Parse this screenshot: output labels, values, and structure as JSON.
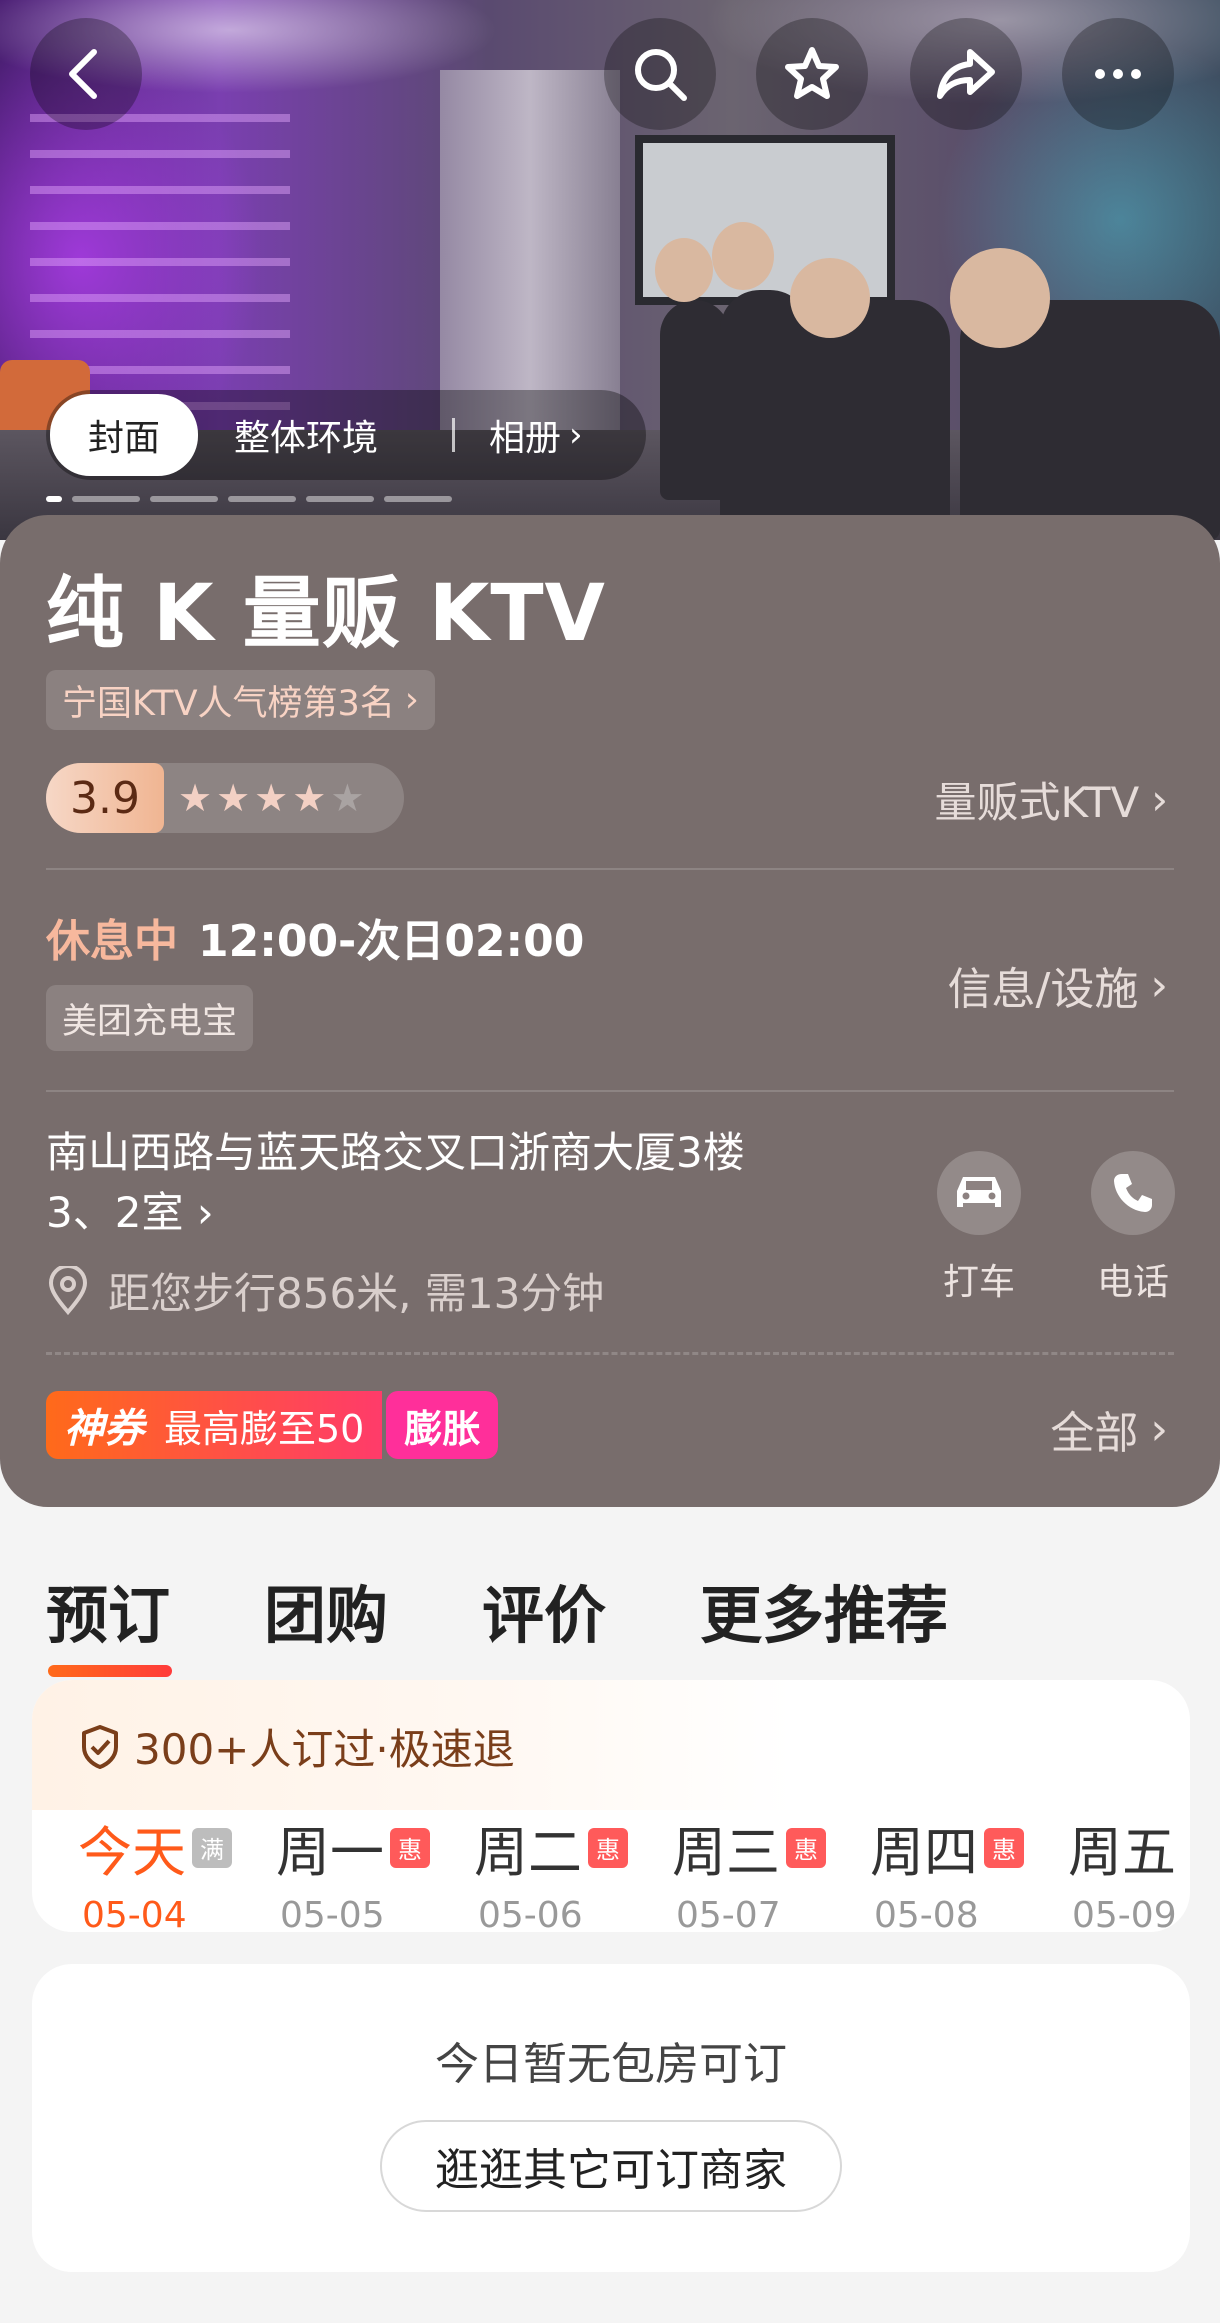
{
  "hero": {
    "album_tabs": [
      "封面",
      "整体环境",
      "相册"
    ]
  },
  "shop": {
    "name": "纯 K 量贩 KTV",
    "rank_tag": "宁国KTV人气榜第3名",
    "rating": "3.9",
    "rating_stars": 3.9,
    "category": "量贩式KTV",
    "status": "休息中",
    "hours": "12:00-次日02:00",
    "charge_tag": "美团充电宝",
    "facility_link": "信息/设施",
    "address_line1": "南山西路与蓝天路交叉口浙商大厦3楼",
    "address_line2": "3、2室",
    "distance": "距您步行856米, 需13分钟",
    "actions": {
      "taxi": "打车",
      "phone": "电话"
    }
  },
  "coupon": {
    "label": "神券",
    "amount": "最高膨至50",
    "expand": "膨胀",
    "all_link": "全部"
  },
  "main_tabs": [
    "预订",
    "团购",
    "评价",
    "更多推荐"
  ],
  "booking": {
    "booked_text": "300+人订过·极速退",
    "days": [
      {
        "week": "今天",
        "date": "05-04",
        "badge": "满"
      },
      {
        "week": "周一",
        "date": "05-05",
        "badge": "惠"
      },
      {
        "week": "周二",
        "date": "05-06",
        "badge": "惠"
      },
      {
        "week": "周三",
        "date": "05-07",
        "badge": "惠"
      },
      {
        "week": "周四",
        "date": "05-08",
        "badge": "惠"
      },
      {
        "week": "周五",
        "date": "05-09",
        "badge": ""
      }
    ]
  },
  "empty": {
    "text": "今日暂无包房可订",
    "button": "逛逛其它可订商家"
  },
  "colors": {
    "info_bg": "#786d6c",
    "accent": "#ff5a1a",
    "coupon_pink": "#ff2f9a"
  }
}
